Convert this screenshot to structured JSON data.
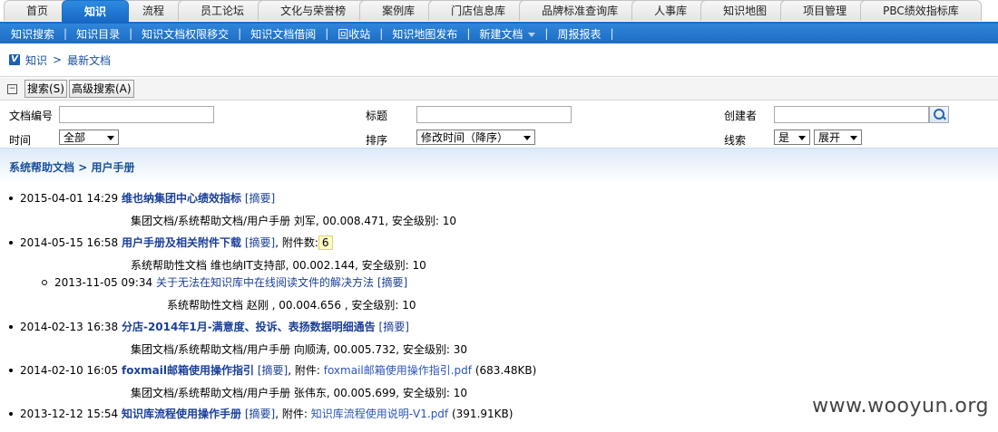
{
  "tabs": [
    {
      "label": "首页",
      "active": false
    },
    {
      "label": "知识",
      "active": true
    },
    {
      "label": "流程",
      "active": false
    },
    {
      "label": "员工论坛",
      "active": false
    },
    {
      "label": "文化与荣誉榜",
      "active": false
    },
    {
      "label": "案例库",
      "active": false
    },
    {
      "label": "门店信息库",
      "active": false
    },
    {
      "label": "品牌标准查询库",
      "active": false
    },
    {
      "label": "人事库",
      "active": false
    },
    {
      "label": "知识地图",
      "active": false
    },
    {
      "label": "项目管理",
      "active": false
    },
    {
      "label": "PBC绩效指标库",
      "active": false
    }
  ],
  "subnav": [
    "知识搜索",
    "知识目录",
    "知识文档权限移交",
    "知识文档借阅",
    "回收站",
    "知识地图发布",
    "新建文档",
    "周报报表"
  ],
  "subnav_sep": "|",
  "breadcrumb": {
    "root": "知识",
    "sep": ">",
    "current": "最新文档"
  },
  "searchbar": {
    "collapse": "−",
    "search": "搜索(S)",
    "advanced": "高级搜索(A)"
  },
  "form": {
    "doc_no_label": "文档编号",
    "title_label": "标题",
    "creator_label": "创建者",
    "time_label": "时间",
    "time_value": "全部",
    "sort_label": "排序",
    "sort_value": "修改时间（降序）",
    "thread_label": "线索",
    "thread_value": "是",
    "expand_value": "展开"
  },
  "section": {
    "path1": "系统帮助文档",
    "sep": ">",
    "path2": "用户手册"
  },
  "docs": [
    {
      "date": "2015-04-01 14:29",
      "title": "维也纳集团中心绩效指标",
      "summary": "[摘要]",
      "meta": "集团文档/系统帮助文档/用户手册  刘军, 00.008.471, 安全级别: 10"
    },
    {
      "date": "2014-05-15 16:58",
      "title": "用户手册及相关附件下载",
      "summary": "[摘要]",
      "attach_label": ", 附件数:",
      "attach_count": "6",
      "meta": "系统帮助性文档 维也纳IT支持部, 00.002.144, 安全级别: 10"
    },
    {
      "date": "2013-11-05 09:34",
      "title": "关于无法在知识库中在线阅读文件的解决方法",
      "summary": "[摘要]",
      "meta": "系统帮助性文档 赵刚 , 00.004.656 , 安全级别: 10"
    },
    {
      "date": "2014-02-13 16:38",
      "title": "分店-2014年1月-满意度、投诉、表扬数据明细通告",
      "summary": "[摘要]",
      "meta": "集团文档/系统帮助文档/用户手册  向顺涛, 00.005.732, 安全级别: 30"
    },
    {
      "date": "2014-02-10 16:05",
      "title": "foxmail邮箱使用操作指引",
      "summary": "[摘要]",
      "attach_label": ", 附件:",
      "attach_file": "foxmail邮箱使用操作指引.pdf",
      "attach_size": "(683.48KB)",
      "meta": "集团文档/系统帮助文档/用户手册  张伟东, 00.005.699, 安全级别: 10"
    },
    {
      "date": "2013-12-12 15:54",
      "title": "知识库流程使用操作手册",
      "summary": "[摘要]",
      "attach_label": ", 附件:",
      "attach_file": "知识库流程使用说明-V1.pdf",
      "attach_size": "(391.91KB)"
    }
  ],
  "watermark": "www.wooyun.org"
}
